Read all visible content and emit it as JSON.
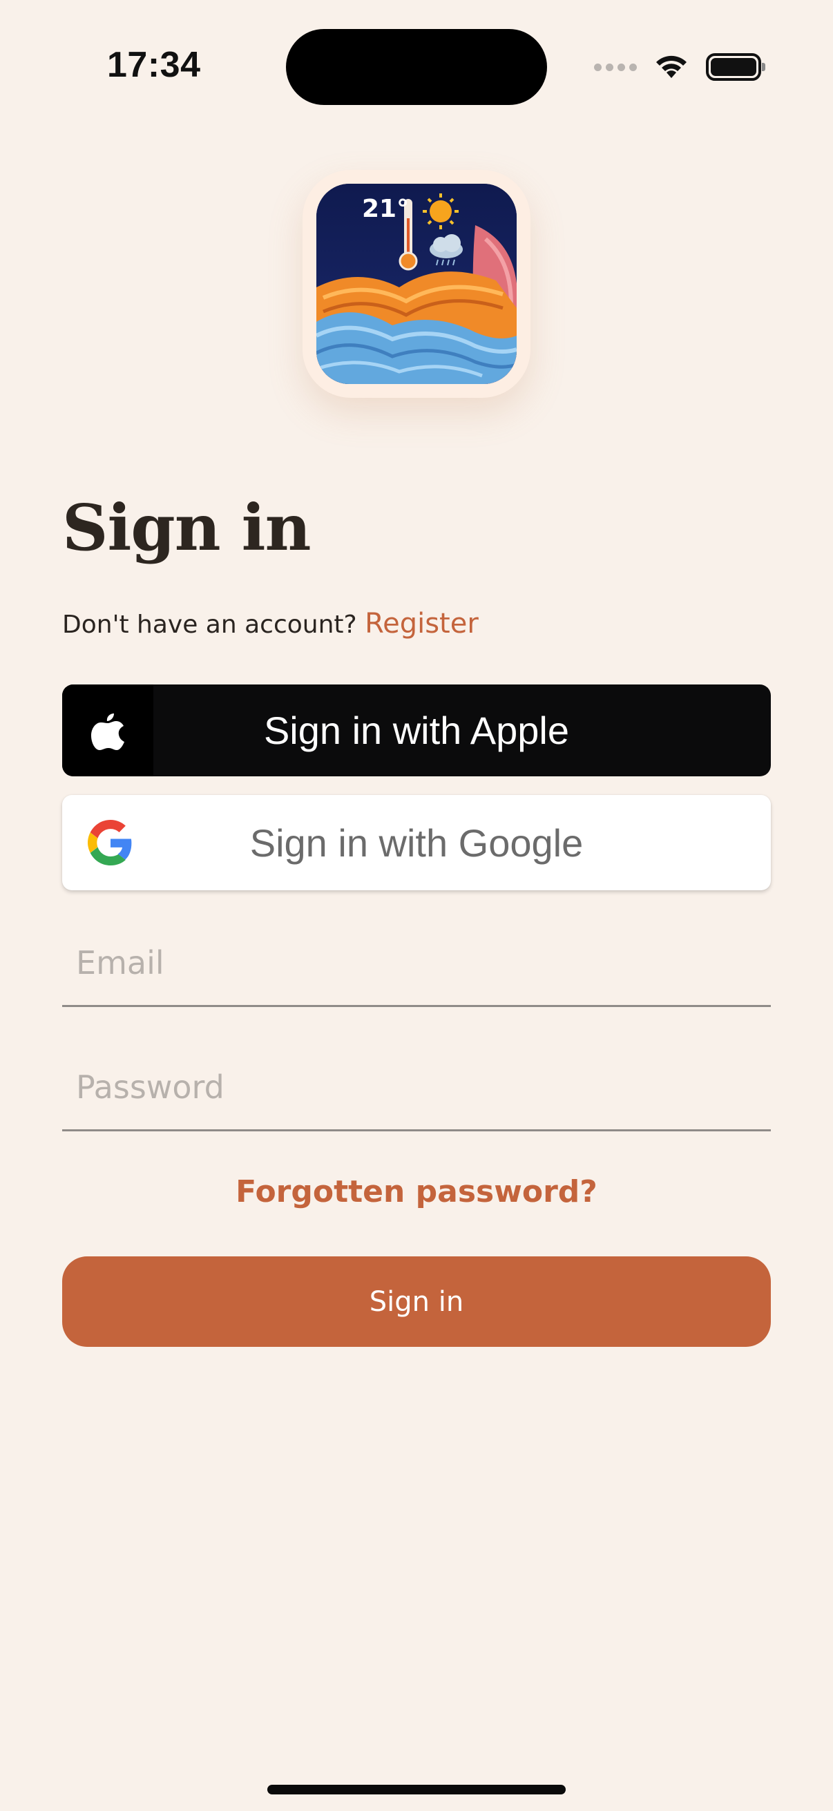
{
  "status_bar": {
    "time": "17:34"
  },
  "app_icon": {
    "temperature": "21°",
    "colors": {
      "background": "#131e55",
      "frame": "#fdeee3"
    },
    "icons": [
      "thermometer-icon",
      "sun-icon",
      "rain-cloud-icon"
    ]
  },
  "page": {
    "title": "Sign in",
    "no_account_text": "Don't have an account?",
    "register_link": "Register"
  },
  "social": {
    "apple_label": "Sign in with Apple",
    "google_label": "Sign in with Google"
  },
  "form": {
    "email_placeholder": "Email",
    "email_value": "",
    "password_placeholder": "Password",
    "password_value": "",
    "forgot_label": "Forgotten password?",
    "submit_label": "Sign in"
  },
  "colors": {
    "background": "#f9f1ea",
    "accent": "#c4643c",
    "text": "#2d2620"
  }
}
